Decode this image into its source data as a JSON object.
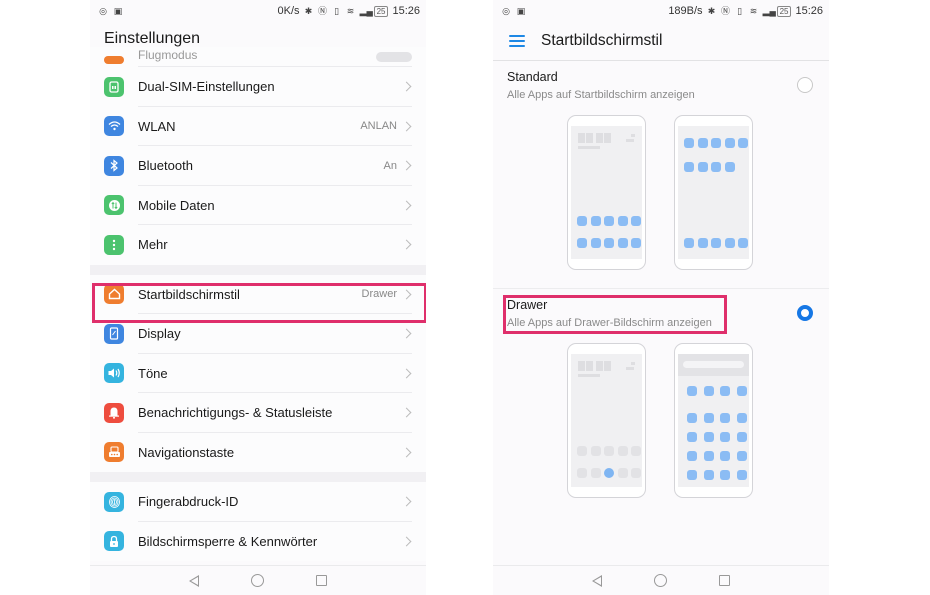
{
  "left_screen": {
    "status_bar": {
      "left_icons": [
        "instagram-icon",
        "notification-icon"
      ],
      "speed": "0K/s",
      "battery": "25",
      "time": "15:26"
    },
    "title": "Einstellungen",
    "partial_item": {
      "label": "Flugmodus",
      "icon": "airplane-icon",
      "toggle": "off"
    },
    "sections": [
      {
        "items": [
          {
            "label": "Dual-SIM-Einstellungen",
            "value": "",
            "icon": "sim-card-icon",
            "color": "#4cc36e"
          },
          {
            "label": "WLAN",
            "value": "ANLAN",
            "icon": "wifi-icon",
            "color": "#3f86e0"
          },
          {
            "label": "Bluetooth",
            "value": "An",
            "icon": "bluetooth-icon",
            "color": "#3f86e0"
          },
          {
            "label": "Mobile Daten",
            "value": "",
            "icon": "mobile-data-icon",
            "color": "#4cc36e"
          },
          {
            "label": "Mehr",
            "value": "",
            "icon": "more-icon",
            "color": "#4cc36e"
          }
        ]
      },
      {
        "items": [
          {
            "label": "Startbildschirmstil",
            "value": "Drawer",
            "icon": "home-icon",
            "color": "#ef7d2f",
            "highlighted": true
          },
          {
            "label": "Display",
            "value": "",
            "icon": "display-icon",
            "color": "#3f86e0"
          },
          {
            "label": "Töne",
            "value": "",
            "icon": "sound-icon",
            "color": "#35b4df"
          },
          {
            "label": "Benachrichtigungs- & Statusleiste",
            "value": "",
            "icon": "bell-icon",
            "color": "#ee4d3f"
          },
          {
            "label": "Navigationstaste",
            "value": "",
            "icon": "navigation-key-icon",
            "color": "#ef7d2f"
          }
        ]
      },
      {
        "items": [
          {
            "label": "Fingerabdruck-ID",
            "value": "",
            "icon": "fingerprint-icon",
            "color": "#35b4df"
          },
          {
            "label": "Bildschirmsperre & Kennwörter",
            "value": "",
            "icon": "lock-icon",
            "color": "#35b4df"
          }
        ]
      }
    ]
  },
  "right_screen": {
    "status_bar": {
      "left_icons": [
        "instagram-icon",
        "notification-icon"
      ],
      "speed": "189B/s",
      "battery": "25",
      "time": "15:26"
    },
    "title": "Startbildschirmstil",
    "options": [
      {
        "title": "Standard",
        "subtitle": "Alle Apps auf Startbildschirm anzeigen",
        "selected": false
      },
      {
        "title": "Drawer",
        "subtitle": "Alle Apps auf Drawer-Bildschirm anzeigen",
        "selected": true,
        "highlighted": true
      }
    ]
  },
  "nav_bar": {
    "buttons": [
      "back",
      "home",
      "recent-apps"
    ]
  },
  "colors": {
    "highlight": "#df2f6b",
    "accent": "#1677e5",
    "app_tile": "#8bbcf4"
  }
}
